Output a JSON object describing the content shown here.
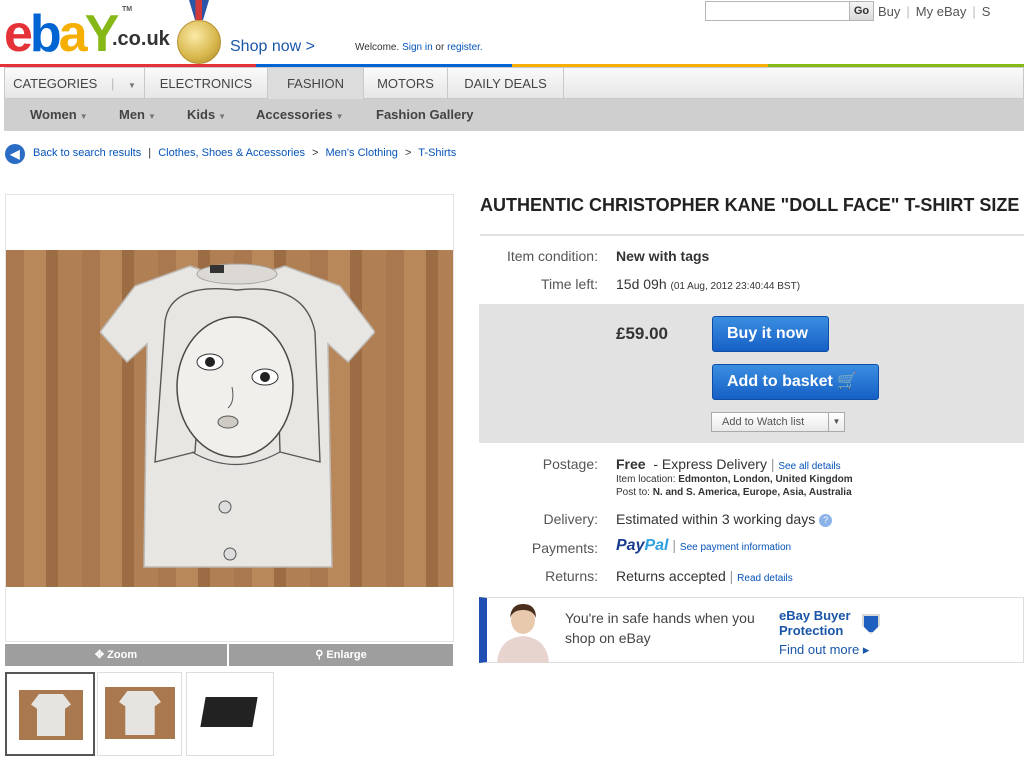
{
  "header": {
    "logo": {
      "e": "e",
      "b": "b",
      "a": "a",
      "y": "Y",
      "domain": ".co.uk",
      "tm": "TM"
    },
    "shop_now": "Shop now >",
    "welcome_prefix": "Welcome.",
    "sign_in": "Sign in",
    "or": "or",
    "register": "register.",
    "search_value": "",
    "go": "Go",
    "links": [
      "Buy",
      "My eBay",
      "S"
    ]
  },
  "nav": {
    "tabs": [
      "CATEGORIES",
      "ELECTRONICS",
      "FASHION",
      "MOTORS",
      "DAILY DEALS"
    ],
    "active_tab": "FASHION",
    "subnav": [
      "Women",
      "Men",
      "Kids",
      "Accessories",
      "Fashion Gallery"
    ]
  },
  "breadcrumb": {
    "back": "Back to search results",
    "path": [
      "Clothes, Shoes & Accessories",
      "Men's Clothing",
      "T-Shirts"
    ]
  },
  "gallery": {
    "zoom": "Zoom",
    "enlarge": "Enlarge",
    "thumbnails": [
      "tshirt-front",
      "tshirt-back",
      "box"
    ]
  },
  "listing": {
    "title": "AUTHENTIC CHRISTOPHER KANE \"DOLL FACE\" T-SHIRT SIZE",
    "condition_label": "Item condition:",
    "condition": "New with tags",
    "time_label": "Time left:",
    "time_left": "15d 09h",
    "time_end": "(01 Aug, 2012 23:40:44 BST)",
    "price": "£59.00",
    "buy_now": "Buy it now",
    "add_basket": "Add to basket",
    "watch_list": "Add to Watch list",
    "postage_label": "Postage:",
    "postage_free": "Free",
    "postage_method": "- Express Delivery",
    "see_details": "See all details",
    "location_label": "Item location:",
    "location": "Edmonton, London, United Kingdom",
    "post_to_label": "Post to:",
    "post_to": "N. and S. America, Europe, Asia, Australia",
    "delivery_label": "Delivery:",
    "delivery": "Estimated within 3 working days",
    "payments_label": "Payments:",
    "paypal_1": "Pay",
    "paypal_2": "Pal",
    "payment_info": "See payment information",
    "returns_label": "Returns:",
    "returns": "Returns accepted",
    "read_details": "Read details"
  },
  "protection": {
    "text": "You're in safe hands when you shop on eBay",
    "title": "eBay Buyer Protection",
    "find_out": "Find out more ▸"
  },
  "colors": {
    "ebay_red": "#e53238",
    "ebay_blue": "#0064d2",
    "ebay_yellow": "#f5af02",
    "ebay_green": "#86b817",
    "button_blue": "#1660c6"
  }
}
